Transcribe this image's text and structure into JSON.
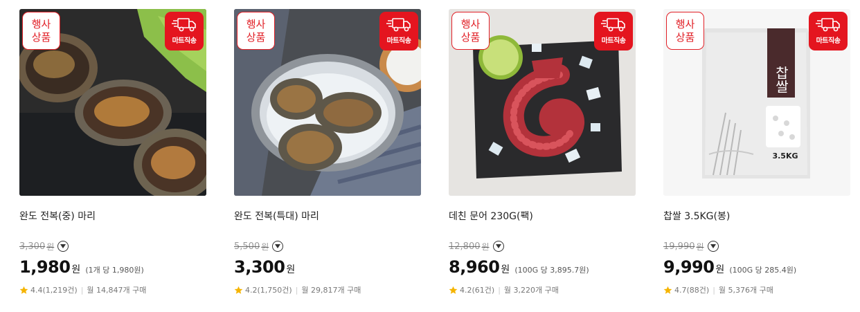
{
  "colors": {
    "accent": "#e11f26",
    "star": "#f5b400"
  },
  "products": [
    {
      "promo_badge_line1": "행사",
      "promo_badge_line2": "상품",
      "ship_badge": "마트직송",
      "title": "완도 전복(중) 마리",
      "original_price": "3,300",
      "original_unit": "원",
      "price": "1,980",
      "price_unit": "원",
      "unit_price": "(1개 당 1,980원)",
      "rating": "4.4(1,219건)",
      "monthly": "월 14,847개 구매"
    },
    {
      "promo_badge_line1": "행사",
      "promo_badge_line2": "상품",
      "ship_badge": "마트직송",
      "title": "완도 전복(특대) 마리",
      "original_price": "5,500",
      "original_unit": "원",
      "price": "3,300",
      "price_unit": "원",
      "unit_price": "",
      "rating": "4.2(1,750건)",
      "monthly": "월 29,817개 구매"
    },
    {
      "promo_badge_line1": "행사",
      "promo_badge_line2": "상품",
      "ship_badge": "마트직송",
      "title": "데친 문어 230G(팩)",
      "original_price": "12,800",
      "original_unit": "원",
      "price": "8,960",
      "price_unit": "원",
      "unit_price": "(100G 당 3,895.7원)",
      "rating": "4.2(61건)",
      "monthly": "월 3,220개 구매"
    },
    {
      "promo_badge_line1": "행사",
      "promo_badge_line2": "상품",
      "ship_badge": "마트직송",
      "title": "찹쌀 3.5KG(봉)",
      "original_price": "19,990",
      "original_unit": "원",
      "price": "9,990",
      "price_unit": "원",
      "unit_price": "(100G 당 285.4원)",
      "rating": "4.7(88건)",
      "monthly": "월 5,376개 구매",
      "package_label": "찹쌀",
      "package_weight": "3.5KG"
    }
  ]
}
